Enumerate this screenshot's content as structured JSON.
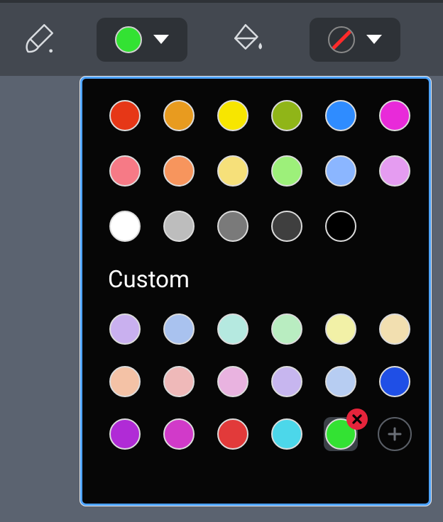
{
  "toolbar": {
    "brush_tool_name": "brush-tool",
    "current_stroke_color": "#33e233",
    "fill_tool_name": "fill-tool",
    "fill_state": "none"
  },
  "palette": {
    "preset_rows": [
      [
        "#e63717",
        "#e89b1f",
        "#f7e600",
        "#90b518",
        "#2f8cff",
        "#e82ad9"
      ],
      [
        "#f67a86",
        "#f7955d",
        "#f6e07a",
        "#9df07a",
        "#8bb6ff",
        "#e59cf1"
      ]
    ],
    "grayscale": [
      "#ffffff",
      "#bdbdbd",
      "#7a7a7a",
      "#3f3f3f",
      "#000000"
    ],
    "custom_label": "Custom",
    "custom_colors": [
      "#c9b0ef",
      "#a9c2ef",
      "#b5e9e0",
      "#b9edc1",
      "#f2f1a7",
      "#f2dfb0",
      "#f4c2a6",
      "#efb9b9",
      "#e9b3e0",
      "#c7b6ef",
      "#b7cdf2",
      "#1f4fe6",
      "#b02bd6",
      "#d13ac9",
      "#e23a3a",
      "#4cd7ea"
    ],
    "selected_custom": "#33e233"
  }
}
